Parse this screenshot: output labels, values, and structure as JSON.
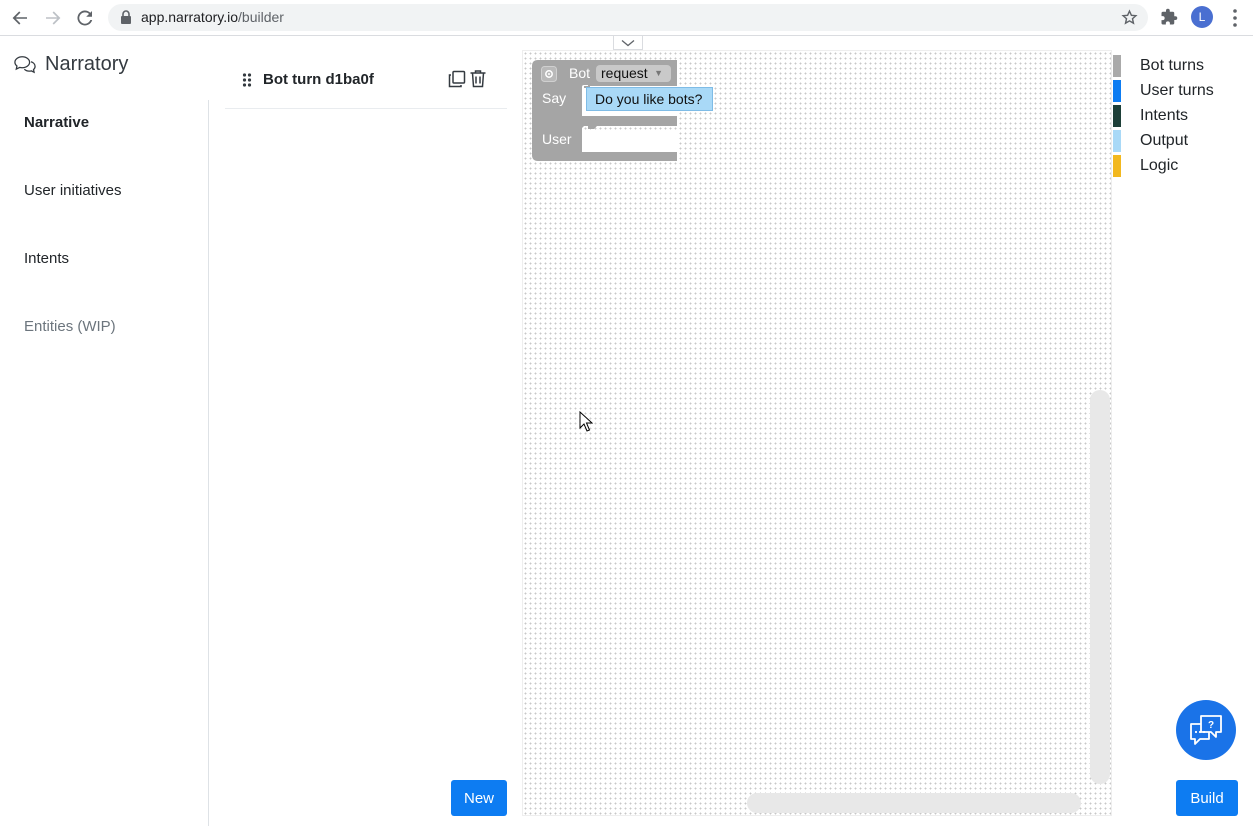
{
  "browser": {
    "url_host": "app.narratory.io",
    "url_path": "/builder",
    "profile_initial": "L"
  },
  "sidebar": {
    "brand": "Narratory",
    "items": [
      {
        "label": "Narrative",
        "state": "active"
      },
      {
        "label": "User initiatives",
        "state": "normal"
      },
      {
        "label": "Intents",
        "state": "normal"
      },
      {
        "label": "Entities (WIP)",
        "state": "muted"
      }
    ]
  },
  "list_panel": {
    "title": "Bot turn d1ba0f",
    "new_label": "New"
  },
  "block": {
    "bot_label": "Bot",
    "type_value": "request",
    "say_label": "Say",
    "say_text": "Do you like bots?",
    "user_label": "User"
  },
  "legend": {
    "items": [
      {
        "label": "Bot turns",
        "color": "#aaaaaa"
      },
      {
        "label": "User turns",
        "color": "#0d7cf2"
      },
      {
        "label": "Intents",
        "color": "#1d3f38"
      },
      {
        "label": "Output",
        "color": "#a9d9f7"
      },
      {
        "label": "Logic",
        "color": "#f2b81f"
      }
    ]
  },
  "actions": {
    "build_label": "Build"
  }
}
